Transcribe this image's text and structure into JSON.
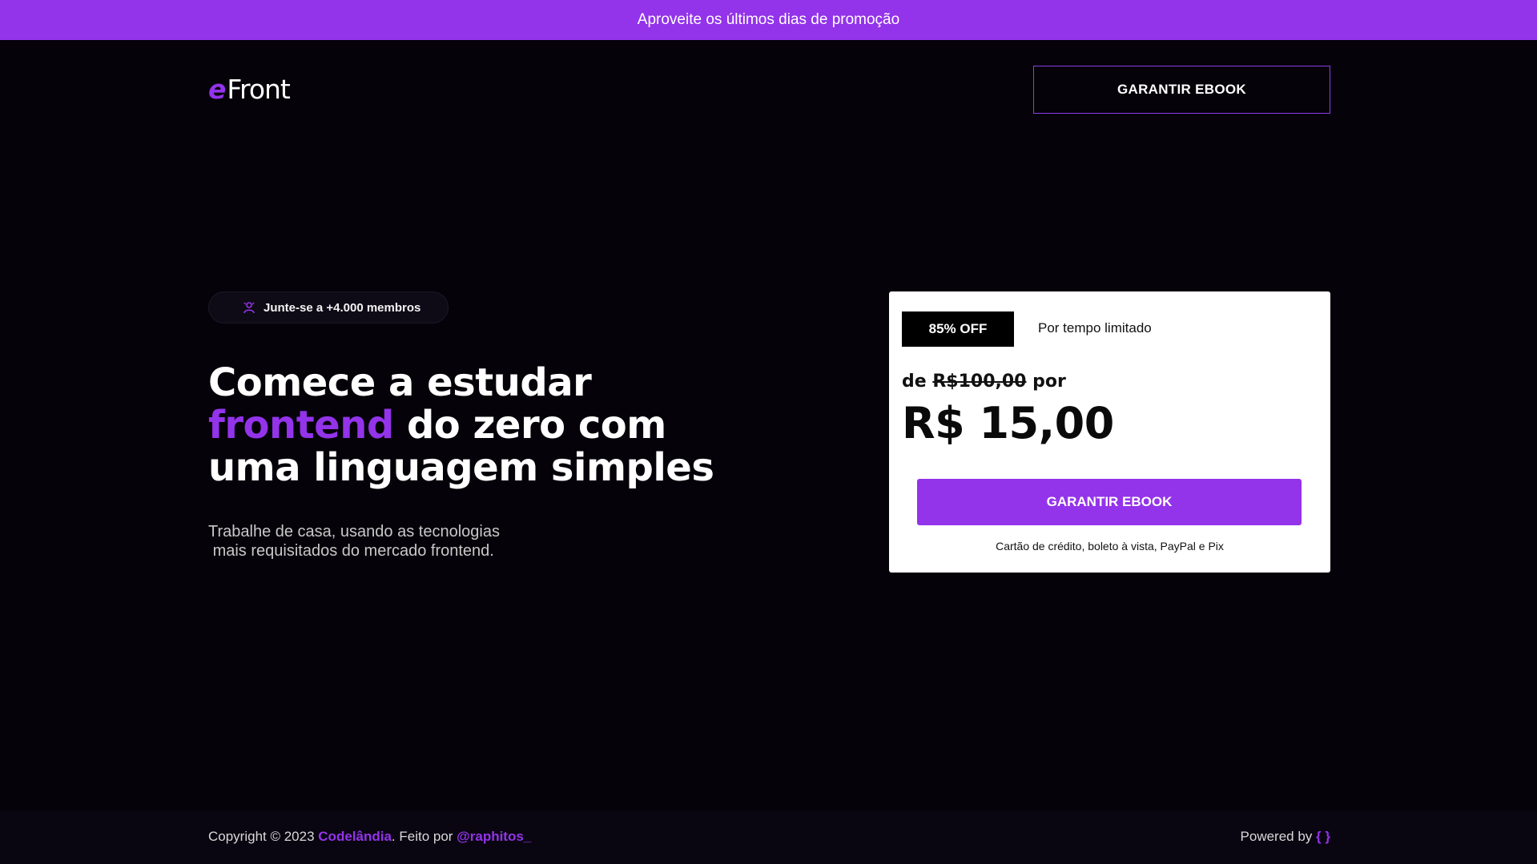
{
  "promo_bar": {
    "text": "Aproveite os últimos dias de promoção"
  },
  "header": {
    "logo_e": "e",
    "logo_text": "Front",
    "cta_label": "GARANTIR EBOOK"
  },
  "hero": {
    "members_text": "Junte-se a +4.000 membros",
    "title_line1": "Comece a estudar",
    "title_accent": "frontend",
    "title_line2_rest": " do zero com",
    "title_line3": "uma linguagem simples",
    "subtitle_line1": "Trabalhe de casa, usando as tecnologias",
    "subtitle_line2": "mais requisitados do mercado frontend."
  },
  "price_card": {
    "discount_badge": "85% OFF",
    "limited_text": "Por tempo limitado",
    "from_prefix": "de ",
    "old_price": "R$100,00",
    "from_suffix": " por",
    "current_price": "R$ 15,00",
    "cta_label": "GARANTIR EBOOK",
    "payment_methods": "Cartão de crédito, boleto à vista, PayPal e Pix"
  },
  "footer": {
    "copyright_prefix": "Copyright © 2023 ",
    "brand": "Codelândia",
    "made_by_prefix": ". Feito por ",
    "author": "@raphitos_",
    "powered_by": "Powered by ",
    "powered_icon": "{ }"
  },
  "colors": {
    "accent": "#9333ea",
    "background": "#050209",
    "card": "#ffffff"
  },
  "icons": {
    "members": "users-icon"
  }
}
